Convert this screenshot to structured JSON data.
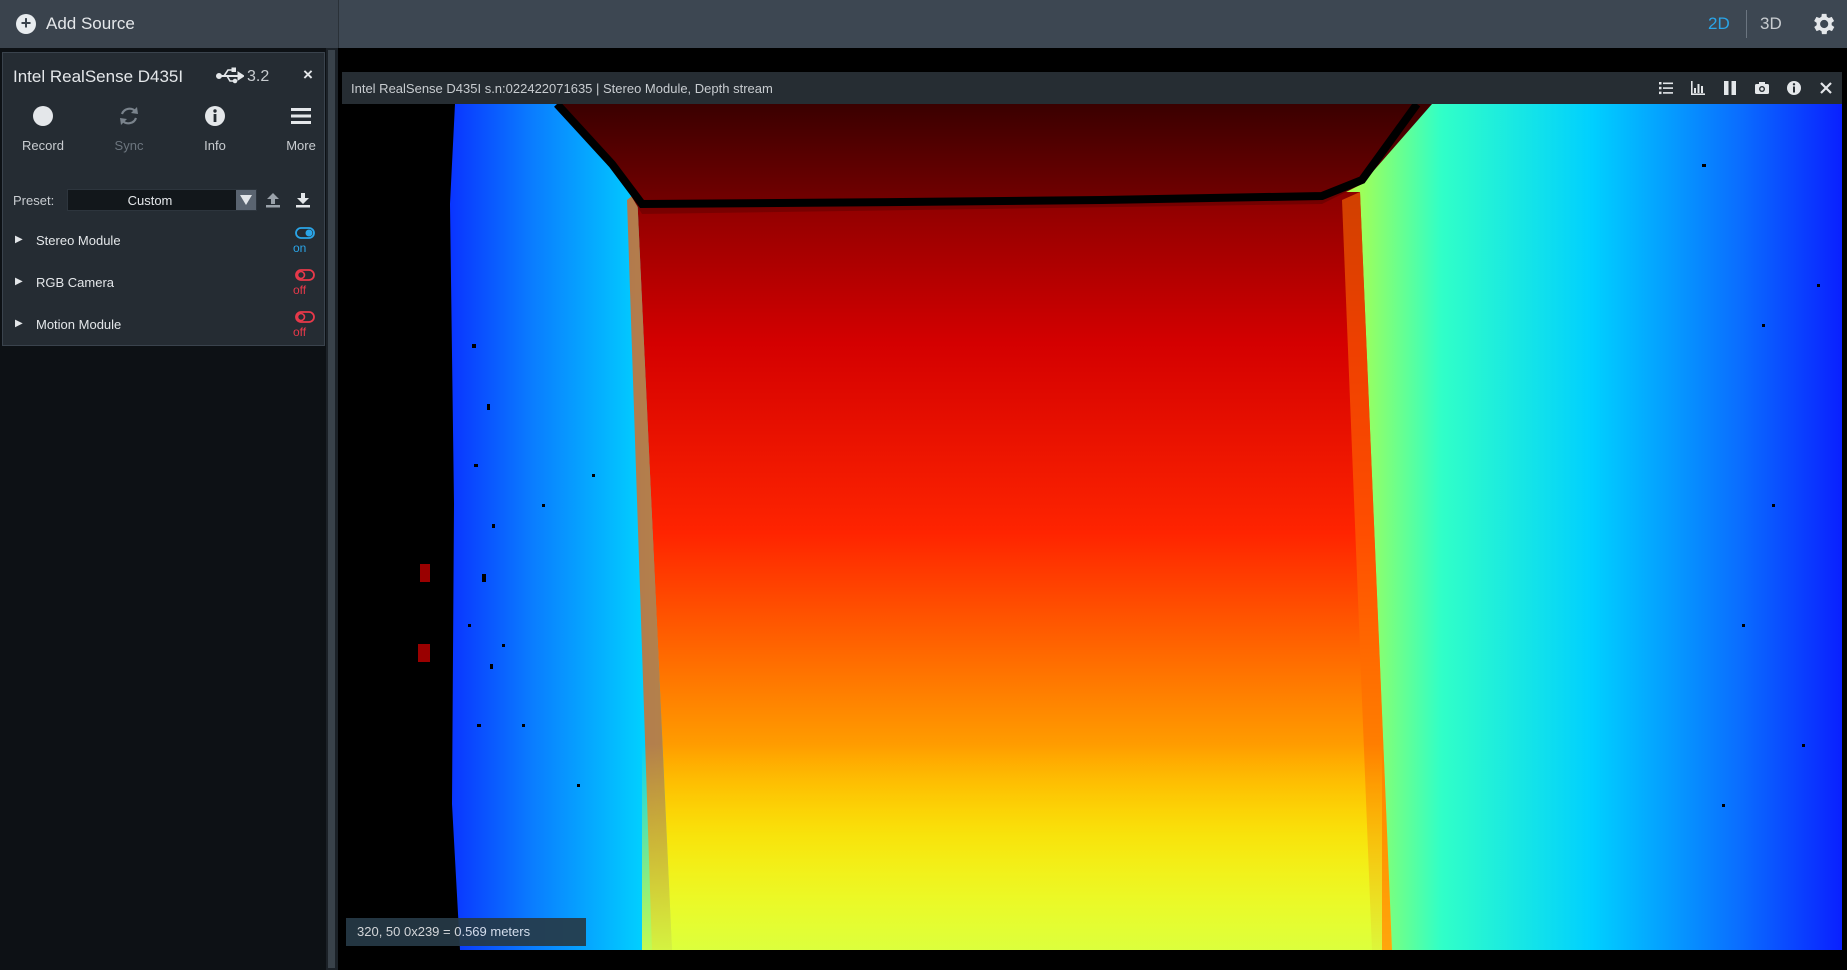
{
  "topbar": {
    "add_source_label": "Add Source",
    "view_2d": "2D",
    "view_3d": "3D",
    "accent_color": "#2aa5e8",
    "settings_icon": "gear-icon"
  },
  "device": {
    "name": "Intel RealSense D435I",
    "usb_version": "3.2",
    "close_label": "×",
    "toolbar": [
      {
        "label": "Record",
        "icon": "record-icon",
        "enabled": true
      },
      {
        "label": "Sync",
        "icon": "sync-icon",
        "enabled": false
      },
      {
        "label": "Info",
        "icon": "info-icon",
        "enabled": true
      },
      {
        "label": "More",
        "icon": "menu-icon",
        "enabled": true
      }
    ],
    "preset_label": "Preset:",
    "preset_value": "Custom",
    "modules": [
      {
        "name": "Stereo Module",
        "state": "on",
        "state_color": "#2aa5e8"
      },
      {
        "name": "RGB Camera",
        "state": "off",
        "state_color": "#e8394a"
      },
      {
        "name": "Motion Module",
        "state": "off",
        "state_color": "#e8394a"
      }
    ]
  },
  "stream": {
    "title": "Intel RealSense D435I s.n:022422071635 | Stereo Module, Depth stream",
    "icons": [
      "list-icon",
      "histogram-icon",
      "pause-icon",
      "camera-icon",
      "info-icon",
      "close-icon"
    ],
    "readout": "320, 50 0x239 = 0.569 meters"
  }
}
